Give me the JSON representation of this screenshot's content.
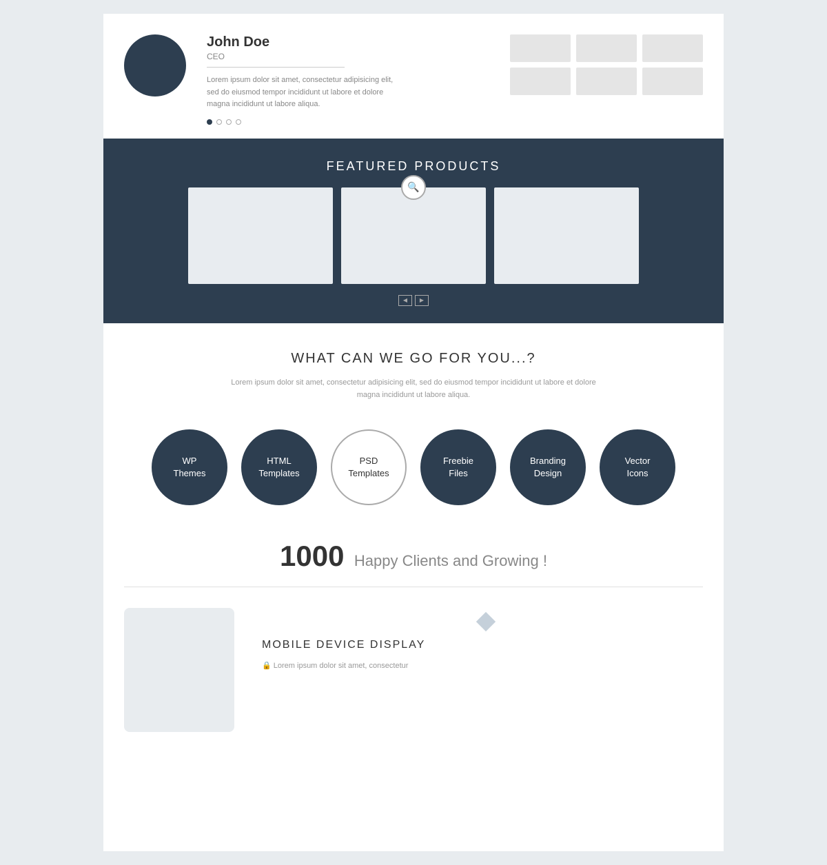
{
  "profile": {
    "name": "John Doe",
    "title": "CEO",
    "bio": "Lorem ipsum dolor sit amet, consectetur adipisicing elit, sed do eiusmod tempor incididunt ut labore et  dolore magna incididunt ut labore aliqua.",
    "dots": [
      "active",
      "inactive",
      "inactive",
      "inactive"
    ]
  },
  "featured": {
    "title": "FEATURED PRODUCTS",
    "zoom_icon": "⊕",
    "prev_label": "◀",
    "next_label": "▶"
  },
  "what": {
    "title": "WHAT CAN WE GO FOR YOU...?",
    "description": "Lorem ipsum dolor sit amet, consectetur adipisicing elit, sed do eiusmod tempor incididunt ut labore et  dolore magna incididunt ut labore aliqua."
  },
  "services": [
    {
      "label": "WP\nThemes",
      "style": "filled"
    },
    {
      "label": "HTML\nTemplates",
      "style": "filled"
    },
    {
      "label": "PSD\nTemplates",
      "style": "outline"
    },
    {
      "label": "Freebie\nFiles",
      "style": "filled"
    },
    {
      "label": "Branding\nDesign",
      "style": "filled"
    },
    {
      "label": "Vector\nIcons",
      "style": "filled"
    }
  ],
  "counter": {
    "number": "1000",
    "text": "Happy Clients and Growing !"
  },
  "mobile": {
    "title": "MOBILE DEVICE DISPLAY",
    "description": "Lorem ipsum dolor sit amet, consectetur",
    "diamond_visible": true,
    "lock_icon": "🔒"
  }
}
